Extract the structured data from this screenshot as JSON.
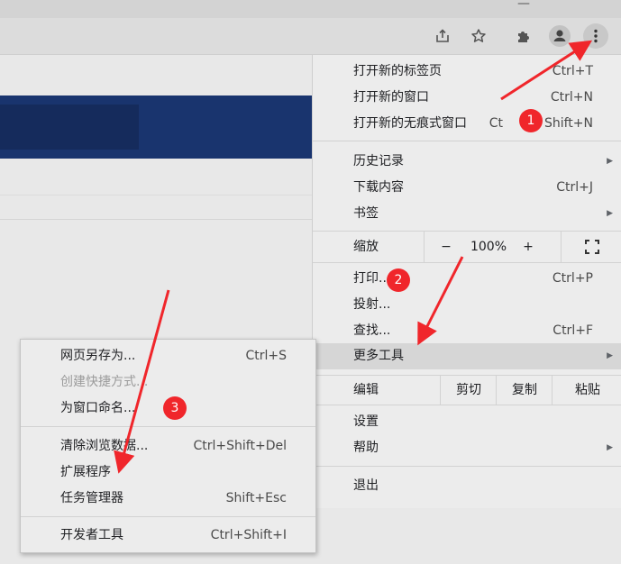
{
  "toolbar": {
    "share_icon": "share-icon",
    "bookmark_icon": "star-icon",
    "extensions_icon": "puzzle-icon",
    "profile_icon": "person-icon",
    "menu_icon": "three-dots-vertical-icon"
  },
  "main_menu": {
    "new_tab": {
      "label": "打开新的标签页",
      "shortcut": "Ctrl+T"
    },
    "new_window": {
      "label": "打开新的窗口",
      "shortcut": "Ctrl+N"
    },
    "new_incognito": {
      "label": "打开新的无痕式窗口",
      "shortcut_prefix": "Ct",
      "shortcut_suffix": "Shift+N"
    },
    "history": {
      "label": "历史记录"
    },
    "downloads": {
      "label": "下载内容",
      "shortcut": "Ctrl+J"
    },
    "bookmarks": {
      "label": "书签"
    },
    "zoom": {
      "label": "缩放",
      "minus": "−",
      "value": "100%",
      "plus": "+"
    },
    "print": {
      "label": "打印...",
      "shortcut": "Ctrl+P"
    },
    "cast": {
      "label": "投射..."
    },
    "find": {
      "label": "查找...",
      "shortcut": "Ctrl+F"
    },
    "more_tools": {
      "label": "更多工具"
    },
    "edit": {
      "label": "编辑",
      "cut": "剪切",
      "copy": "复制",
      "paste": "粘贴"
    },
    "settings": {
      "label": "设置"
    },
    "help": {
      "label": "帮助"
    },
    "exit": {
      "label": "退出"
    }
  },
  "sub_menu": {
    "save_page": {
      "label": "网页另存为...",
      "shortcut": "Ctrl+S"
    },
    "create_shortcut": {
      "label": "创建快捷方式..."
    },
    "name_window": {
      "label": "为窗口命名..."
    },
    "clear_data": {
      "label": "清除浏览数据...",
      "shortcut": "Ctrl+Shift+Del"
    },
    "extensions": {
      "label": "扩展程序"
    },
    "task_manager": {
      "label": "任务管理器",
      "shortcut": "Shift+Esc"
    },
    "dev_tools": {
      "label": "开发者工具",
      "shortcut": "Ctrl+Shift+I"
    }
  },
  "annotations": {
    "badge1": "1",
    "badge2": "2",
    "badge3": "3",
    "color": "#f0262b"
  },
  "colors": {
    "banner": "#19346e",
    "menu_bg": "#ececec",
    "highlight": "#d6d6d6"
  }
}
